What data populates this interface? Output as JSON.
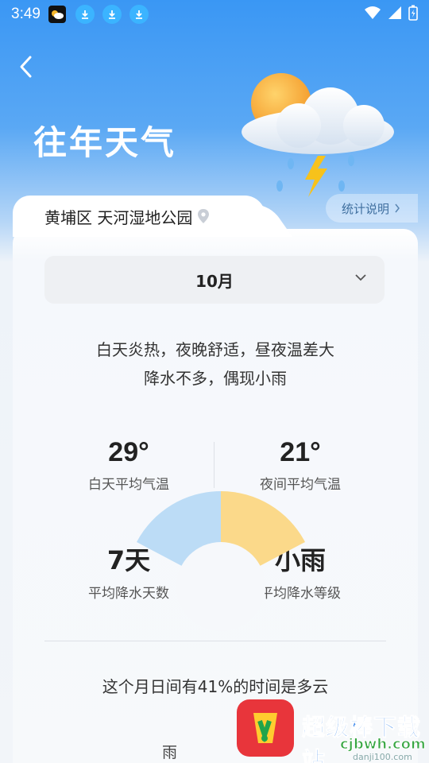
{
  "status_bar": {
    "time": "3:49",
    "icons": [
      "weather-notification-icon",
      "download-icon",
      "download-icon",
      "download-icon",
      "wifi-icon",
      "signal-icon",
      "battery-icon"
    ]
  },
  "header": {
    "title": "往年天气",
    "back_icon": "chevron-left-icon"
  },
  "location": {
    "name": "黄埔区 天河湿地公园",
    "icon": "location-pin-icon"
  },
  "stats_button": {
    "label": "统计说明",
    "icon": "chevron-right-icon"
  },
  "month_selector": {
    "selected": "10月",
    "icon": "chevron-down-icon"
  },
  "description": {
    "line1": "白天炎热，夜晚舒适，昼夜温差大",
    "line2": "降水不多，偶现小雨"
  },
  "stats": [
    {
      "value": "29°",
      "label": "白天平均气温"
    },
    {
      "value": "21°",
      "label": "夜间平均气温"
    },
    {
      "value": "7天",
      "label": "平均降水天数"
    },
    {
      "value": "小雨",
      "label": "平均降水等级"
    }
  ],
  "cloud_summary": "这个月日间有41%的时间是多云",
  "chart_data": {
    "type": "pie",
    "categories": [
      "雨"
    ],
    "values": []
  },
  "colors": {
    "sky_blue": "#3a97f4",
    "pie_blue": "#bcdcf6",
    "pie_yellow": "#fbd98a",
    "text_dark": "#222222"
  },
  "watermark": {
    "title": "超级棒下载站",
    "sub": "单机100网",
    "url": "cjbwh.com",
    "url2": "danji100.com"
  }
}
